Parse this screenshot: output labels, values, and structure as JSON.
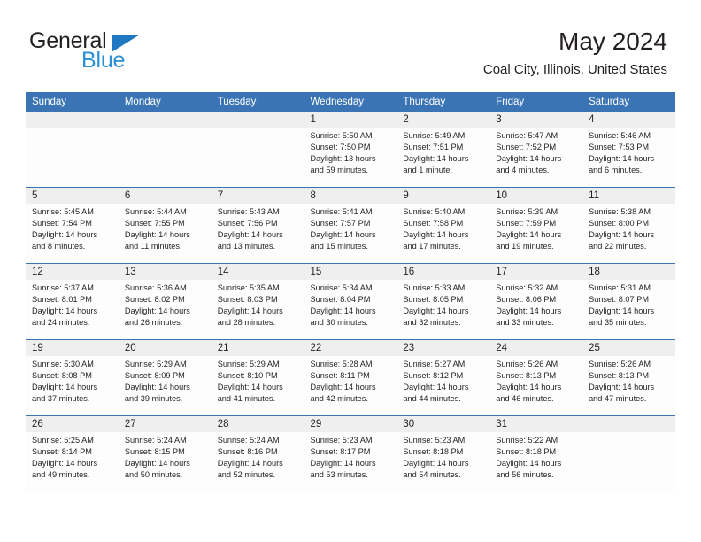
{
  "brand": {
    "name_part1": "General",
    "name_part2": "Blue",
    "accent_color": "#2a8fd4",
    "triangle_color": "#1f78c1"
  },
  "header": {
    "month_title": "May 2024",
    "location": "Coal City, Illinois, United States"
  },
  "theme": {
    "header_bg": "#3a74b4",
    "daynum_bg": "#efefef",
    "rule_color": "#3a74b4",
    "text_color": "#231f20"
  },
  "weekday_headers": [
    "Sunday",
    "Monday",
    "Tuesday",
    "Wednesday",
    "Thursday",
    "Friday",
    "Saturday"
  ],
  "weeks": [
    {
      "days": [
        {
          "num": "",
          "sunrise": "",
          "sunset": "",
          "daylight_1": "",
          "daylight_2": ""
        },
        {
          "num": "",
          "sunrise": "",
          "sunset": "",
          "daylight_1": "",
          "daylight_2": ""
        },
        {
          "num": "",
          "sunrise": "",
          "sunset": "",
          "daylight_1": "",
          "daylight_2": ""
        },
        {
          "num": "1",
          "sunrise": "Sunrise: 5:50 AM",
          "sunset": "Sunset: 7:50 PM",
          "daylight_1": "Daylight: 13 hours",
          "daylight_2": "and 59 minutes."
        },
        {
          "num": "2",
          "sunrise": "Sunrise: 5:49 AM",
          "sunset": "Sunset: 7:51 PM",
          "daylight_1": "Daylight: 14 hours",
          "daylight_2": "and 1 minute."
        },
        {
          "num": "3",
          "sunrise": "Sunrise: 5:47 AM",
          "sunset": "Sunset: 7:52 PM",
          "daylight_1": "Daylight: 14 hours",
          "daylight_2": "and 4 minutes."
        },
        {
          "num": "4",
          "sunrise": "Sunrise: 5:46 AM",
          "sunset": "Sunset: 7:53 PM",
          "daylight_1": "Daylight: 14 hours",
          "daylight_2": "and 6 minutes."
        }
      ]
    },
    {
      "days": [
        {
          "num": "5",
          "sunrise": "Sunrise: 5:45 AM",
          "sunset": "Sunset: 7:54 PM",
          "daylight_1": "Daylight: 14 hours",
          "daylight_2": "and 8 minutes."
        },
        {
          "num": "6",
          "sunrise": "Sunrise: 5:44 AM",
          "sunset": "Sunset: 7:55 PM",
          "daylight_1": "Daylight: 14 hours",
          "daylight_2": "and 11 minutes."
        },
        {
          "num": "7",
          "sunrise": "Sunrise: 5:43 AM",
          "sunset": "Sunset: 7:56 PM",
          "daylight_1": "Daylight: 14 hours",
          "daylight_2": "and 13 minutes."
        },
        {
          "num": "8",
          "sunrise": "Sunrise: 5:41 AM",
          "sunset": "Sunset: 7:57 PM",
          "daylight_1": "Daylight: 14 hours",
          "daylight_2": "and 15 minutes."
        },
        {
          "num": "9",
          "sunrise": "Sunrise: 5:40 AM",
          "sunset": "Sunset: 7:58 PM",
          "daylight_1": "Daylight: 14 hours",
          "daylight_2": "and 17 minutes."
        },
        {
          "num": "10",
          "sunrise": "Sunrise: 5:39 AM",
          "sunset": "Sunset: 7:59 PM",
          "daylight_1": "Daylight: 14 hours",
          "daylight_2": "and 19 minutes."
        },
        {
          "num": "11",
          "sunrise": "Sunrise: 5:38 AM",
          "sunset": "Sunset: 8:00 PM",
          "daylight_1": "Daylight: 14 hours",
          "daylight_2": "and 22 minutes."
        }
      ]
    },
    {
      "days": [
        {
          "num": "12",
          "sunrise": "Sunrise: 5:37 AM",
          "sunset": "Sunset: 8:01 PM",
          "daylight_1": "Daylight: 14 hours",
          "daylight_2": "and 24 minutes."
        },
        {
          "num": "13",
          "sunrise": "Sunrise: 5:36 AM",
          "sunset": "Sunset: 8:02 PM",
          "daylight_1": "Daylight: 14 hours",
          "daylight_2": "and 26 minutes."
        },
        {
          "num": "14",
          "sunrise": "Sunrise: 5:35 AM",
          "sunset": "Sunset: 8:03 PM",
          "daylight_1": "Daylight: 14 hours",
          "daylight_2": "and 28 minutes."
        },
        {
          "num": "15",
          "sunrise": "Sunrise: 5:34 AM",
          "sunset": "Sunset: 8:04 PM",
          "daylight_1": "Daylight: 14 hours",
          "daylight_2": "and 30 minutes."
        },
        {
          "num": "16",
          "sunrise": "Sunrise: 5:33 AM",
          "sunset": "Sunset: 8:05 PM",
          "daylight_1": "Daylight: 14 hours",
          "daylight_2": "and 32 minutes."
        },
        {
          "num": "17",
          "sunrise": "Sunrise: 5:32 AM",
          "sunset": "Sunset: 8:06 PM",
          "daylight_1": "Daylight: 14 hours",
          "daylight_2": "and 33 minutes."
        },
        {
          "num": "18",
          "sunrise": "Sunrise: 5:31 AM",
          "sunset": "Sunset: 8:07 PM",
          "daylight_1": "Daylight: 14 hours",
          "daylight_2": "and 35 minutes."
        }
      ]
    },
    {
      "days": [
        {
          "num": "19",
          "sunrise": "Sunrise: 5:30 AM",
          "sunset": "Sunset: 8:08 PM",
          "daylight_1": "Daylight: 14 hours",
          "daylight_2": "and 37 minutes."
        },
        {
          "num": "20",
          "sunrise": "Sunrise: 5:29 AM",
          "sunset": "Sunset: 8:09 PM",
          "daylight_1": "Daylight: 14 hours",
          "daylight_2": "and 39 minutes."
        },
        {
          "num": "21",
          "sunrise": "Sunrise: 5:29 AM",
          "sunset": "Sunset: 8:10 PM",
          "daylight_1": "Daylight: 14 hours",
          "daylight_2": "and 41 minutes."
        },
        {
          "num": "22",
          "sunrise": "Sunrise: 5:28 AM",
          "sunset": "Sunset: 8:11 PM",
          "daylight_1": "Daylight: 14 hours",
          "daylight_2": "and 42 minutes."
        },
        {
          "num": "23",
          "sunrise": "Sunrise: 5:27 AM",
          "sunset": "Sunset: 8:12 PM",
          "daylight_1": "Daylight: 14 hours",
          "daylight_2": "and 44 minutes."
        },
        {
          "num": "24",
          "sunrise": "Sunrise: 5:26 AM",
          "sunset": "Sunset: 8:13 PM",
          "daylight_1": "Daylight: 14 hours",
          "daylight_2": "and 46 minutes."
        },
        {
          "num": "25",
          "sunrise": "Sunrise: 5:26 AM",
          "sunset": "Sunset: 8:13 PM",
          "daylight_1": "Daylight: 14 hours",
          "daylight_2": "and 47 minutes."
        }
      ]
    },
    {
      "days": [
        {
          "num": "26",
          "sunrise": "Sunrise: 5:25 AM",
          "sunset": "Sunset: 8:14 PM",
          "daylight_1": "Daylight: 14 hours",
          "daylight_2": "and 49 minutes."
        },
        {
          "num": "27",
          "sunrise": "Sunrise: 5:24 AM",
          "sunset": "Sunset: 8:15 PM",
          "daylight_1": "Daylight: 14 hours",
          "daylight_2": "and 50 minutes."
        },
        {
          "num": "28",
          "sunrise": "Sunrise: 5:24 AM",
          "sunset": "Sunset: 8:16 PM",
          "daylight_1": "Daylight: 14 hours",
          "daylight_2": "and 52 minutes."
        },
        {
          "num": "29",
          "sunrise": "Sunrise: 5:23 AM",
          "sunset": "Sunset: 8:17 PM",
          "daylight_1": "Daylight: 14 hours",
          "daylight_2": "and 53 minutes."
        },
        {
          "num": "30",
          "sunrise": "Sunrise: 5:23 AM",
          "sunset": "Sunset: 8:18 PM",
          "daylight_1": "Daylight: 14 hours",
          "daylight_2": "and 54 minutes."
        },
        {
          "num": "31",
          "sunrise": "Sunrise: 5:22 AM",
          "sunset": "Sunset: 8:18 PM",
          "daylight_1": "Daylight: 14 hours",
          "daylight_2": "and 56 minutes."
        },
        {
          "num": "",
          "sunrise": "",
          "sunset": "",
          "daylight_1": "",
          "daylight_2": ""
        }
      ]
    }
  ]
}
